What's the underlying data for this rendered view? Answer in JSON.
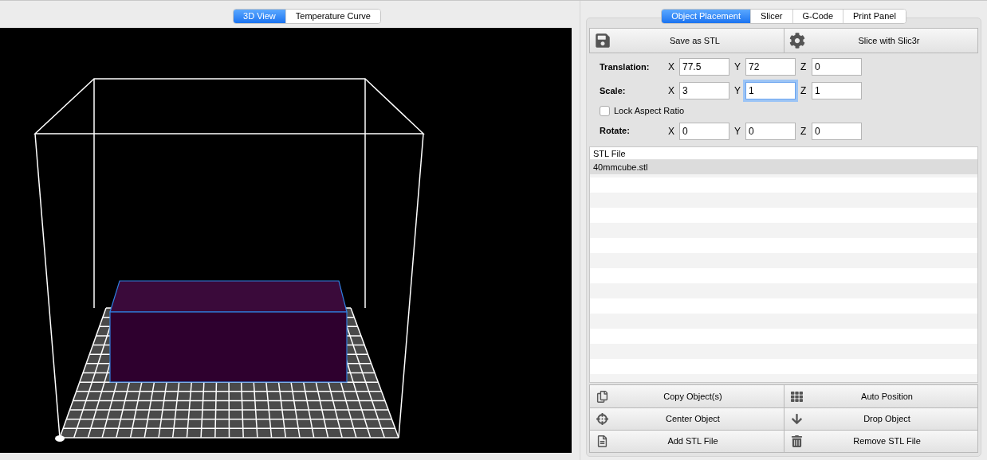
{
  "view_tabs": [
    {
      "label": "3D View",
      "selected": true
    },
    {
      "label": "Temperature Curve",
      "selected": false
    }
  ],
  "panel_tabs": [
    {
      "label": "Object Placement",
      "selected": true
    },
    {
      "label": "Slicer",
      "selected": false
    },
    {
      "label": "G-Code",
      "selected": false
    },
    {
      "label": "Print Panel",
      "selected": false
    }
  ],
  "toolbar": [
    {
      "label": "Save as STL"
    },
    {
      "label": "Slice with Slic3r"
    }
  ],
  "transform": [
    {
      "label": "Translation:",
      "fields": [
        {
          "axis": "X",
          "value": "77.5",
          "focused": false
        },
        {
          "axis": "Y",
          "value": "72",
          "focused": false
        },
        {
          "axis": "Z",
          "value": "0",
          "focused": false
        }
      ]
    },
    {
      "label": "Scale:",
      "fields": [
        {
          "axis": "X",
          "value": "3",
          "focused": false
        },
        {
          "axis": "Y",
          "value": "1",
          "focused": true
        },
        {
          "axis": "Z",
          "value": "1",
          "focused": false
        }
      ]
    },
    {
      "kind": "checkbox",
      "label": "Lock Aspect Ratio",
      "checked": false
    },
    {
      "label": "Rotate:",
      "fields": [
        {
          "axis": "X",
          "value": "0",
          "focused": false
        },
        {
          "axis": "Y",
          "value": "0",
          "focused": false
        },
        {
          "axis": "Z",
          "value": "0",
          "focused": false
        }
      ]
    }
  ],
  "file_table": {
    "column": "STL File",
    "rows": [
      {
        "name": "40mmcube.stl",
        "selected": true
      }
    ]
  },
  "actions": [
    {
      "label": "Copy Object(s)"
    },
    {
      "label": "Auto Position"
    },
    {
      "label": "Center Object"
    },
    {
      "label": "Drop Object"
    },
    {
      "label": "Add STL File"
    },
    {
      "label": "Remove STL File"
    }
  ]
}
